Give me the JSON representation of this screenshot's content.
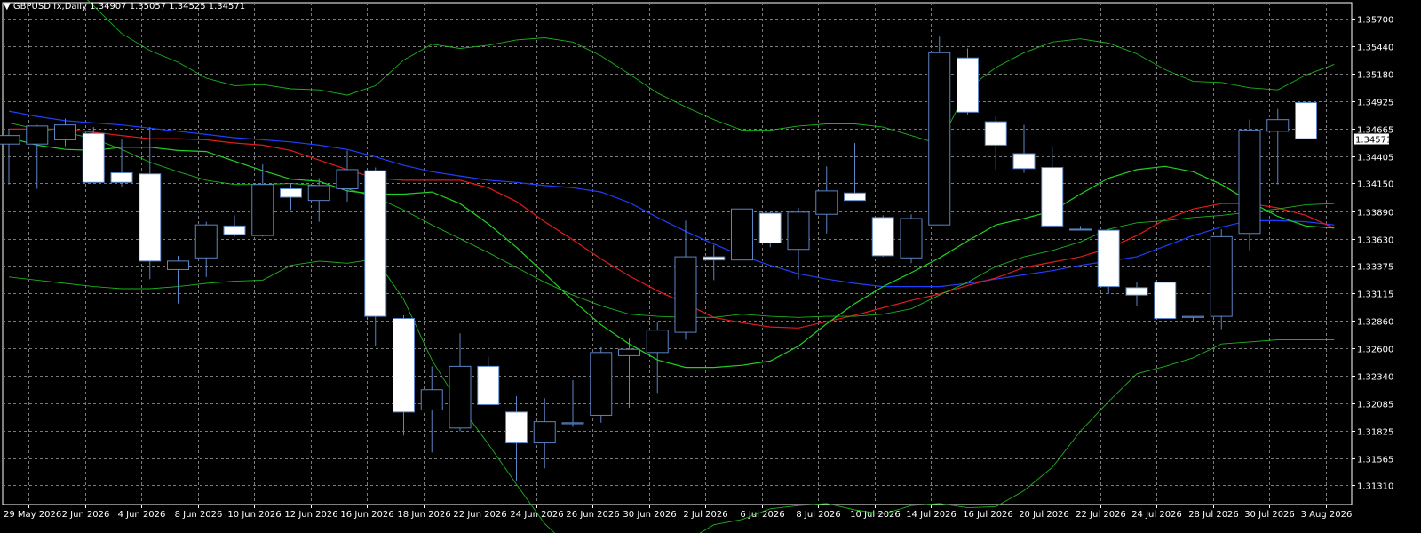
{
  "header": {
    "symbol_arrow": "▼",
    "title": "GBPUSD.fx,Daily  1.34907 1.35057 1.34525 1.34571"
  },
  "colors": {
    "background": "#000000",
    "grid": "#7a7a7a",
    "axis": "#ffffff",
    "candle_bull": "#000000",
    "candle_bear": "#ffffff",
    "candle_border": "#5b84c4",
    "ma_blue": "#1f3fff",
    "ma_red": "#e01b1b",
    "ma_green": "#22d122",
    "bollinger": "#22d122",
    "current_price_line": "#8fa8c0"
  },
  "chart_data": {
    "type": "candlestick",
    "symbol": "GBPUSD.fx",
    "timeframe": "Daily",
    "ylim": [
      1.3113,
      1.3585
    ],
    "y_ticks": [
      "1.35700",
      "1.35440",
      "1.35180",
      "1.34925",
      "1.34665",
      "1.34405",
      "1.34150",
      "1.33890",
      "1.33630",
      "1.33375",
      "1.33115",
      "1.32860",
      "1.32600",
      "1.32340",
      "1.32085",
      "1.31825",
      "1.31565",
      "1.31310"
    ],
    "x_labels": [
      "29 May 2026",
      "2 Jun 2026",
      "4 Jun 2026",
      "8 Jun 2026",
      "10 Jun 2026",
      "12 Jun 2026",
      "16 Jun 2026",
      "18 Jun 2026",
      "22 Jun 2026",
      "24 Jun 2026",
      "26 Jun 2026",
      "30 Jun 2026",
      "2 Jul 2026",
      "6 Jul 2026",
      "8 Jul 2026",
      "10 Jul 2026",
      "14 Jul 2026",
      "16 Jul 2026",
      "20 Jul 2026",
      "22 Jul 2026",
      "24 Jul 2026",
      "28 Jul 2026",
      "30 Jul 2026",
      "3 Aug 2026"
    ],
    "current_price": "1.34571",
    "candles": [
      {
        "o": 1.3452,
        "h": 1.3466,
        "l": 1.3414,
        "c": 1.346
      },
      {
        "o": 1.3452,
        "h": 1.347,
        "l": 1.341,
        "c": 1.3469
      },
      {
        "o": 1.3456,
        "h": 1.3476,
        "l": 1.345,
        "c": 1.347
      },
      {
        "o": 1.3462,
        "h": 1.3468,
        "l": 1.3416,
        "c": 1.3416
      },
      {
        "o": 1.3425,
        "h": 1.3457,
        "l": 1.3412,
        "c": 1.3416
      },
      {
        "o": 1.3424,
        "h": 1.3468,
        "l": 1.3325,
        "c": 1.3342
      },
      {
        "o": 1.3334,
        "h": 1.3347,
        "l": 1.3302,
        "c": 1.3342
      },
      {
        "o": 1.3345,
        "h": 1.3379,
        "l": 1.3327,
        "c": 1.3376
      },
      {
        "o": 1.3375,
        "h": 1.3385,
        "l": 1.3365,
        "c": 1.3367
      },
      {
        "o": 1.3366,
        "h": 1.3433,
        "l": 1.3365,
        "c": 1.3414
      },
      {
        "o": 1.341,
        "h": 1.3415,
        "l": 1.339,
        "c": 1.3402
      },
      {
        "o": 1.3399,
        "h": 1.342,
        "l": 1.3379,
        "c": 1.3413
      },
      {
        "o": 1.341,
        "h": 1.3446,
        "l": 1.3398,
        "c": 1.3428
      },
      {
        "o": 1.3427,
        "h": 1.343,
        "l": 1.3262,
        "c": 1.329
      },
      {
        "o": 1.3288,
        "h": 1.3291,
        "l": 1.3178,
        "c": 1.32
      },
      {
        "o": 1.3202,
        "h": 1.3243,
        "l": 1.3162,
        "c": 1.3221
      },
      {
        "o": 1.3185,
        "h": 1.3274,
        "l": 1.3182,
        "c": 1.3243
      },
      {
        "o": 1.3243,
        "h": 1.3252,
        "l": 1.3208,
        "c": 1.3207
      },
      {
        "o": 1.32,
        "h": 1.3215,
        "l": 1.3135,
        "c": 1.3171
      },
      {
        "o": 1.3171,
        "h": 1.3213,
        "l": 1.3147,
        "c": 1.3191
      },
      {
        "o": 1.3189,
        "h": 1.323,
        "l": 1.3186,
        "c": 1.319
      },
      {
        "o": 1.3197,
        "h": 1.3261,
        "l": 1.319,
        "c": 1.3256
      },
      {
        "o": 1.3253,
        "h": 1.3269,
        "l": 1.3204,
        "c": 1.3259
      },
      {
        "o": 1.3256,
        "h": 1.3285,
        "l": 1.3218,
        "c": 1.3277
      },
      {
        "o": 1.3275,
        "h": 1.338,
        "l": 1.3268,
        "c": 1.3346
      },
      {
        "o": 1.3346,
        "h": 1.3357,
        "l": 1.3324,
        "c": 1.3343
      },
      {
        "o": 1.3343,
        "h": 1.3393,
        "l": 1.333,
        "c": 1.3391
      },
      {
        "o": 1.3387,
        "h": 1.3388,
        "l": 1.3355,
        "c": 1.3359
      },
      {
        "o": 1.3353,
        "h": 1.3392,
        "l": 1.3325,
        "c": 1.3388
      },
      {
        "o": 1.3386,
        "h": 1.3431,
        "l": 1.3368,
        "c": 1.3408
      },
      {
        "o": 1.3406,
        "h": 1.3453,
        "l": 1.34,
        "c": 1.3399
      },
      {
        "o": 1.3383,
        "h": 1.3385,
        "l": 1.3346,
        "c": 1.3347
      },
      {
        "o": 1.3345,
        "h": 1.3386,
        "l": 1.334,
        "c": 1.3382
      },
      {
        "o": 1.3376,
        "h": 1.3553,
        "l": 1.344,
        "c": 1.3538
      },
      {
        "o": 1.3533,
        "h": 1.3542,
        "l": 1.348,
        "c": 1.3482
      },
      {
        "o": 1.3473,
        "h": 1.3478,
        "l": 1.3428,
        "c": 1.3451
      },
      {
        "o": 1.3443,
        "h": 1.347,
        "l": 1.3425,
        "c": 1.3429
      },
      {
        "o": 1.343,
        "h": 1.345,
        "l": 1.3375,
        "c": 1.3375
      },
      {
        "o": 1.3372,
        "h": 1.3375,
        "l": 1.3372,
        "c": 1.3372
      },
      {
        "o": 1.3371,
        "h": 1.3372,
        "l": 1.3311,
        "c": 1.3318
      },
      {
        "o": 1.3317,
        "h": 1.3322,
        "l": 1.33,
        "c": 1.331
      },
      {
        "o": 1.3322,
        "h": 1.3322,
        "l": 1.3288,
        "c": 1.3288
      },
      {
        "o": 1.3289,
        "h": 1.329,
        "l": 1.3285,
        "c": 1.329
      },
      {
        "o": 1.329,
        "h": 1.3372,
        "l": 1.3278,
        "c": 1.3365
      },
      {
        "o": 1.3368,
        "h": 1.3475,
        "l": 1.3352,
        "c": 1.3465
      },
      {
        "o": 1.3464,
        "h": 1.3485,
        "l": 1.3414,
        "c": 1.3475
      },
      {
        "o": 1.3491,
        "h": 1.3506,
        "l": 1.3453,
        "c": 1.3457
      }
    ],
    "indicators": [
      {
        "kind": "moving-average",
        "color": "blue",
        "values": [
          1.3483,
          1.3478,
          1.3474,
          1.3472,
          1.347,
          1.3467,
          1.3464,
          1.3461,
          1.3458,
          1.3456,
          1.3454,
          1.3451,
          1.3447,
          1.344,
          1.3432,
          1.3426,
          1.3422,
          1.3418,
          1.3416,
          1.3413,
          1.3411,
          1.3407,
          1.3397,
          1.3383,
          1.337,
          1.3358,
          1.3347,
          1.3338,
          1.333,
          1.3325,
          1.3321,
          1.3318,
          1.3318,
          1.3318,
          1.3321,
          1.3325,
          1.3329,
          1.3333,
          1.3338,
          1.3342,
          1.3346,
          1.3356,
          1.3366,
          1.3374,
          1.338,
          1.338,
          1.3379,
          1.3376
        ]
      },
      {
        "kind": "moving-average",
        "color": "red",
        "values": [
          1.3466,
          1.3466,
          1.3466,
          1.3463,
          1.346,
          1.3457,
          1.3457,
          1.3456,
          1.3453,
          1.3451,
          1.3446,
          1.3437,
          1.3428,
          1.342,
          1.3418,
          1.3418,
          1.3418,
          1.3411,
          1.3398,
          1.3379,
          1.3362,
          1.3344,
          1.3328,
          1.3314,
          1.3302,
          1.3289,
          1.3284,
          1.328,
          1.3279,
          1.3285,
          1.3291,
          1.3298,
          1.3305,
          1.3311,
          1.3319,
          1.3326,
          1.3336,
          1.3341,
          1.3346,
          1.3354,
          1.3366,
          1.3381,
          1.3391,
          1.3396,
          1.3396,
          1.3392,
          1.3385,
          1.3373
        ]
      },
      {
        "kind": "moving-average",
        "color": "green",
        "values": [
          1.3458,
          1.3451,
          1.3447,
          1.3446,
          1.3449,
          1.3449,
          1.3446,
          1.3445,
          1.3436,
          1.3427,
          1.3419,
          1.3417,
          1.3408,
          1.3405,
          1.3405,
          1.3407,
          1.3396,
          1.3377,
          1.3355,
          1.333,
          1.3305,
          1.3282,
          1.3264,
          1.3249,
          1.3242,
          1.3242,
          1.3244,
          1.3248,
          1.3262,
          1.3283,
          1.3302,
          1.3318,
          1.3331,
          1.3345,
          1.3361,
          1.3376,
          1.3382,
          1.3389,
          1.3405,
          1.342,
          1.3428,
          1.3431,
          1.3426,
          1.3414,
          1.3398,
          1.3384,
          1.3375,
          1.3373
        ]
      },
      {
        "kind": "bollinger-upper",
        "color": "green",
        "values": [
          1.3636,
          1.3625,
          1.3608,
          1.3582,
          1.3556,
          1.354,
          1.3529,
          1.3514,
          1.3507,
          1.3508,
          1.3504,
          1.3503,
          1.3498,
          1.3507,
          1.3531,
          1.3546,
          1.3542,
          1.3545,
          1.355,
          1.3552,
          1.3548,
          1.3535,
          1.3518,
          1.35,
          1.3487,
          1.3475,
          1.3465,
          1.3465,
          1.3469,
          1.3471,
          1.3471,
          1.3468,
          1.346,
          1.3452,
          1.3504,
          1.3524,
          1.3538,
          1.3548,
          1.3551,
          1.3547,
          1.3537,
          1.3522,
          1.3511,
          1.351,
          1.3505,
          1.3503,
          1.3517,
          1.3527
        ]
      },
      {
        "kind": "bollinger-mid",
        "color": "green",
        "values": [
          1.3472,
          1.3466,
          1.3463,
          1.3457,
          1.3447,
          1.3435,
          1.3426,
          1.3418,
          1.3414,
          1.3414,
          1.3415,
          1.3413,
          1.341,
          1.3402,
          1.339,
          1.3376,
          1.3363,
          1.335,
          1.3336,
          1.3322,
          1.331,
          1.33,
          1.3292,
          1.329,
          1.3289,
          1.3289,
          1.3292,
          1.329,
          1.3289,
          1.329,
          1.329,
          1.3292,
          1.3297,
          1.331,
          1.3322,
          1.3337,
          1.3346,
          1.3352,
          1.336,
          1.3372,
          1.3378,
          1.338,
          1.3383,
          1.3385,
          1.3388,
          1.3391,
          1.3395,
          1.3396
        ]
      },
      {
        "kind": "bollinger-lower",
        "color": "green",
        "values": [
          1.3327,
          1.3324,
          1.3321,
          1.3318,
          1.3316,
          1.3316,
          1.3318,
          1.3321,
          1.3323,
          1.3324,
          1.3338,
          1.3342,
          1.334,
          1.3344,
          1.3306,
          1.3249,
          1.3206,
          1.317,
          1.3132,
          1.3095,
          1.307,
          1.3061,
          1.3064,
          1.3068,
          1.3078,
          1.3094,
          1.3099,
          1.3109,
          1.3112,
          1.3114,
          1.3108,
          1.3104,
          1.3112,
          1.3114,
          1.311,
          1.3111,
          1.3126,
          1.3148,
          1.3182,
          1.321,
          1.3236,
          1.3243,
          1.3251,
          1.3264,
          1.3266,
          1.3268,
          1.3268,
          1.3268
        ]
      }
    ]
  }
}
